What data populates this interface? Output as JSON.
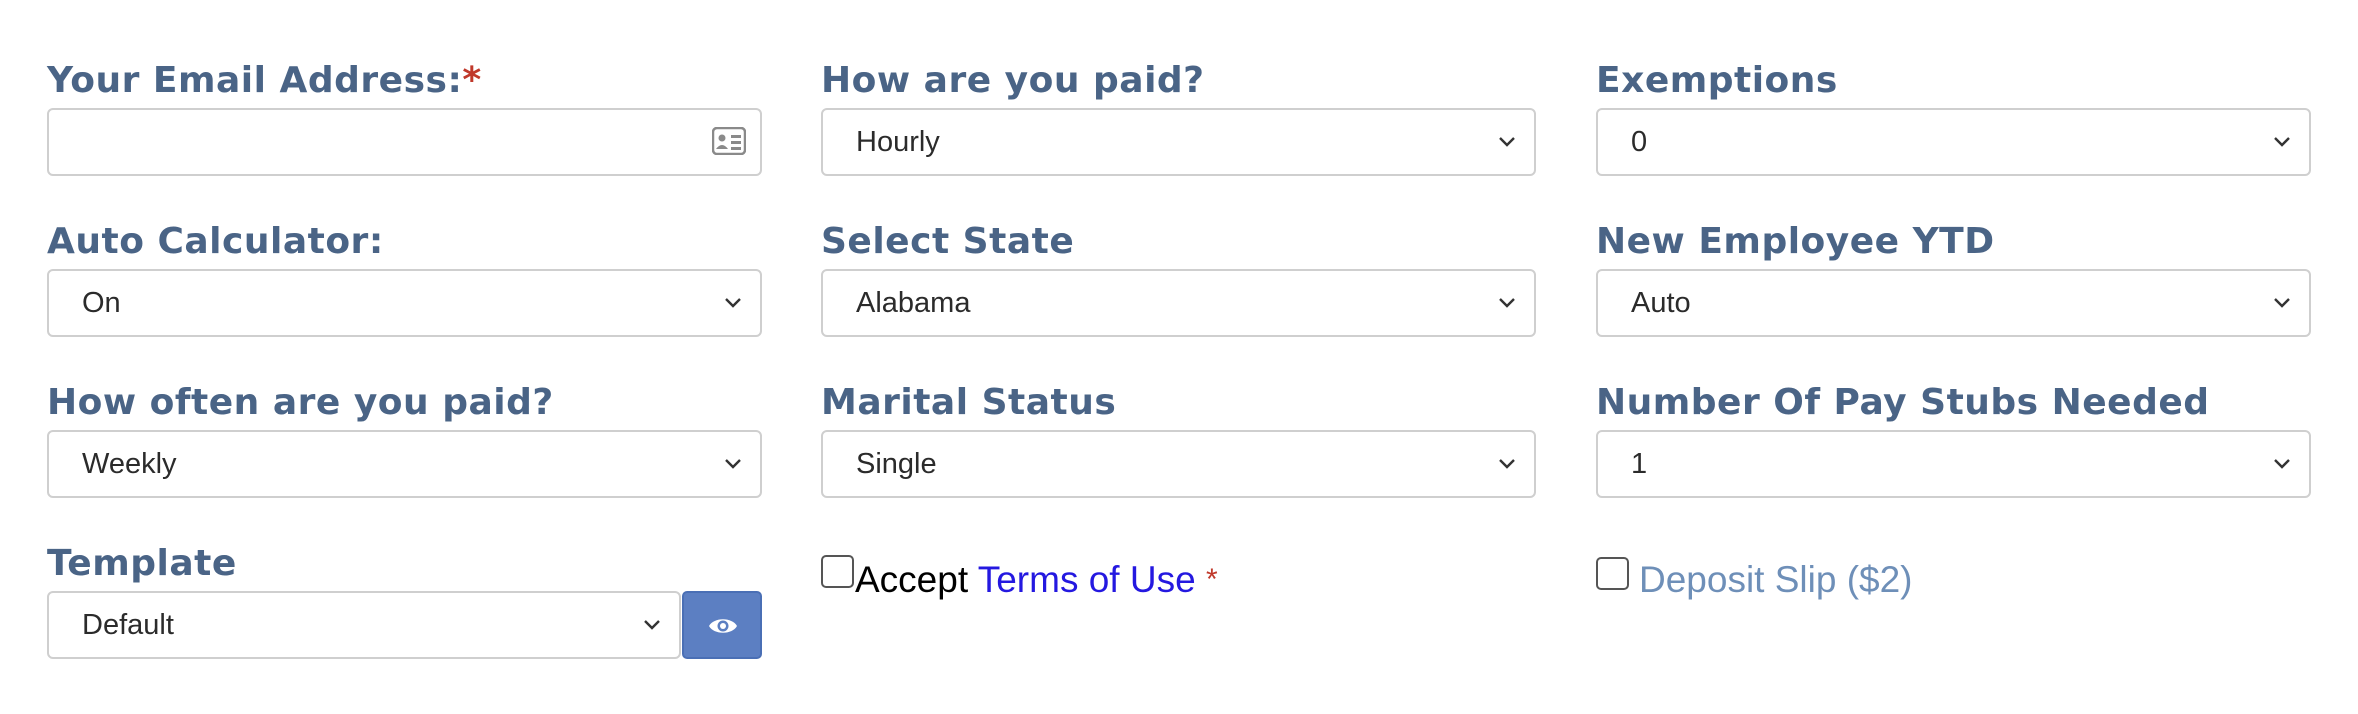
{
  "form": {
    "email": {
      "label": "Your Email Address:",
      "required_mark": "*",
      "value": "",
      "icon": "contact-card-icon"
    },
    "pay_type": {
      "label": "How are you paid?",
      "value": "Hourly"
    },
    "exemptions": {
      "label": "Exemptions",
      "value": "0"
    },
    "auto_calculator": {
      "label": "Auto Calculator:",
      "value": "On"
    },
    "state": {
      "label": "Select State",
      "value": "Alabama"
    },
    "new_employee_ytd": {
      "label": "New Employee YTD",
      "value": "Auto"
    },
    "pay_frequency": {
      "label": "How often are you paid?",
      "value": "Weekly"
    },
    "marital_status": {
      "label": "Marital Status",
      "value": "Single"
    },
    "stubs_needed": {
      "label": "Number Of Pay Stubs Needed",
      "value": "1"
    },
    "template": {
      "label": "Template",
      "value": "Default",
      "preview_icon": "eye-icon"
    },
    "terms": {
      "accept_text": "Accept ",
      "link_text": "Terms of Use",
      "required_mark": "*",
      "checked": false
    },
    "deposit_slip": {
      "label": "Deposit Slip ($2)",
      "checked": false
    }
  },
  "colors": {
    "label": "#4a6486",
    "required": "#c0392b",
    "link": "#2418e0",
    "muted_link": "#6e8fb8",
    "button": "#5c7fc2",
    "border": "#cfcfcf"
  }
}
